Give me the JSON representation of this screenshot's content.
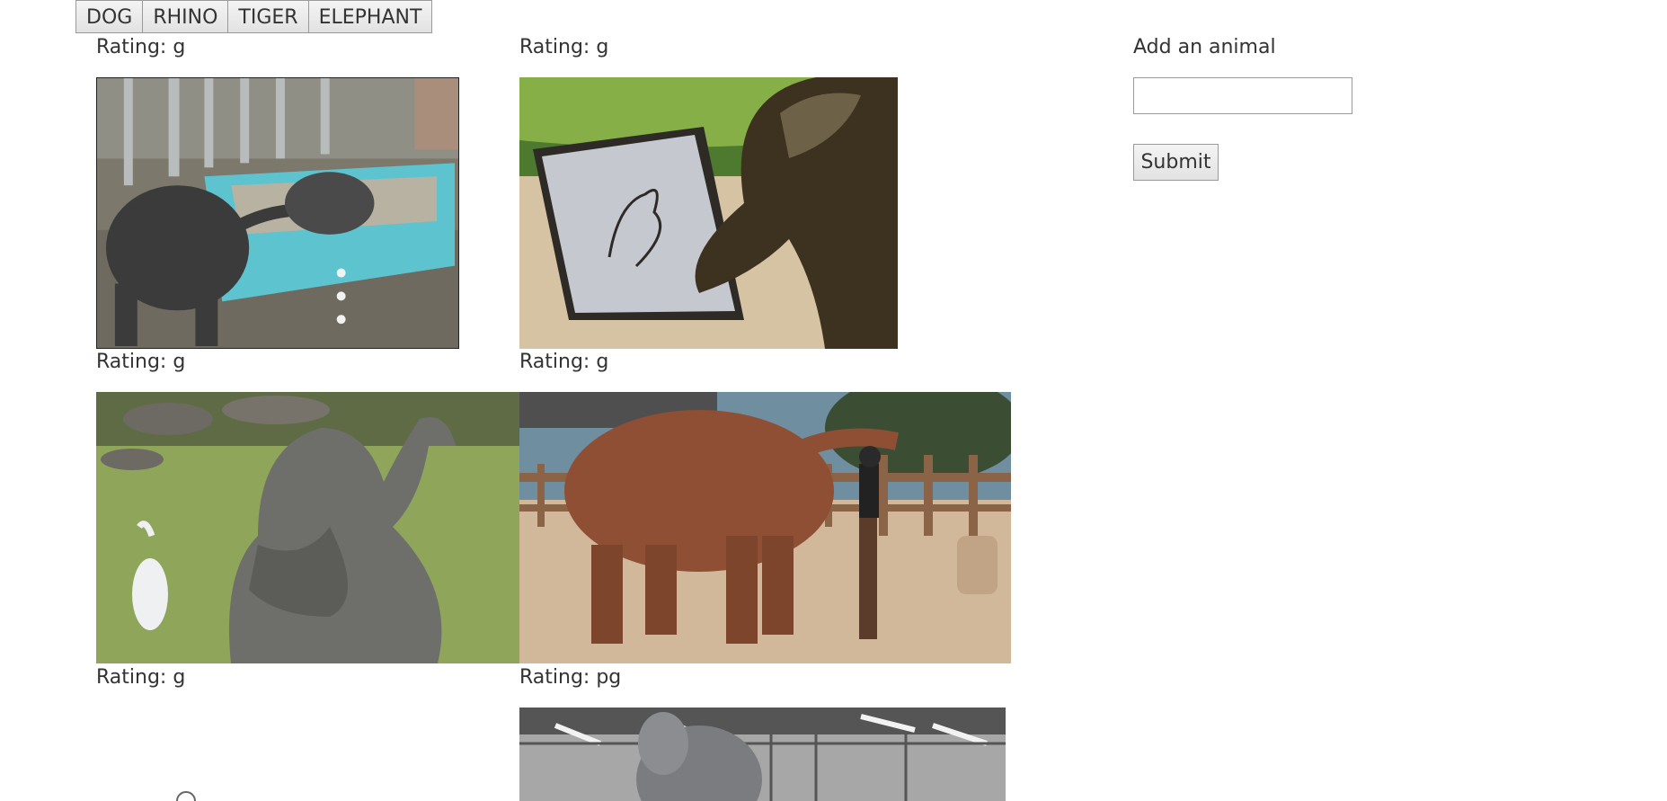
{
  "animal_buttons": [
    "DOG",
    "RHINO",
    "TIGER",
    "ELEPHANT"
  ],
  "gifs": [
    {
      "rating": "Rating: g"
    },
    {
      "rating": "Rating: g"
    },
    {
      "rating": "Rating: g"
    },
    {
      "rating": "Rating: g"
    },
    {
      "rating": "Rating: g"
    },
    {
      "rating": "Rating: pg"
    }
  ],
  "form": {
    "label": "Add an animal",
    "input_value": "",
    "input_placeholder": "",
    "submit_label": "Submit"
  }
}
